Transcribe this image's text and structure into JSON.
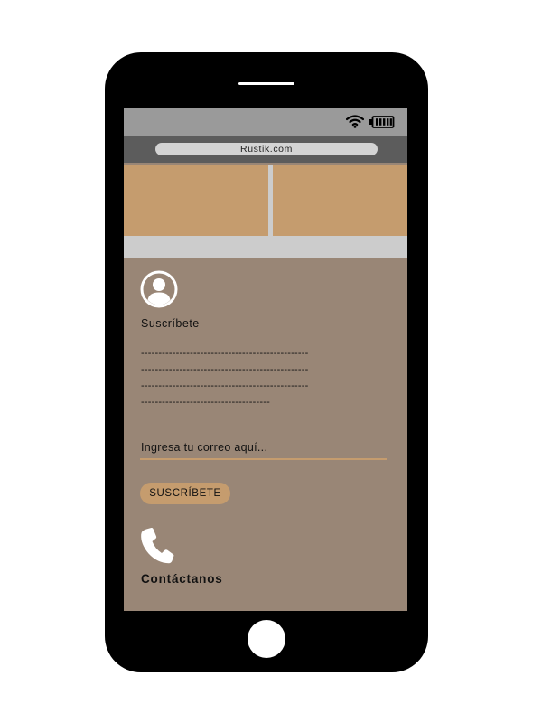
{
  "browser": {
    "url": "Rustik.com"
  },
  "status_bar": {
    "icons": [
      "wifi-icon",
      "battery-icon"
    ]
  },
  "subscribe": {
    "icon": "user-avatar-icon",
    "title": "Suscríbete",
    "description_lines": [
      "------------------------------------------------",
      "------------------------------------------------",
      "------------------------------------------------",
      "-------------------------------------"
    ],
    "email_placeholder": "Ingresa tu correo aquí...",
    "button_label": "SUSCRÍBETE"
  },
  "contact": {
    "icon": "phone-icon",
    "label": "Contáctanos"
  },
  "colors": {
    "phone_body": "#000000",
    "status_bar": "#9a9a9a",
    "address_bar": "#5c5c5c",
    "url_pill": "#d4d4d4",
    "hero_block": "#c59c6e",
    "grey_band": "#cccccc",
    "content_background": "#998676",
    "accent": "#c59c6e"
  }
}
